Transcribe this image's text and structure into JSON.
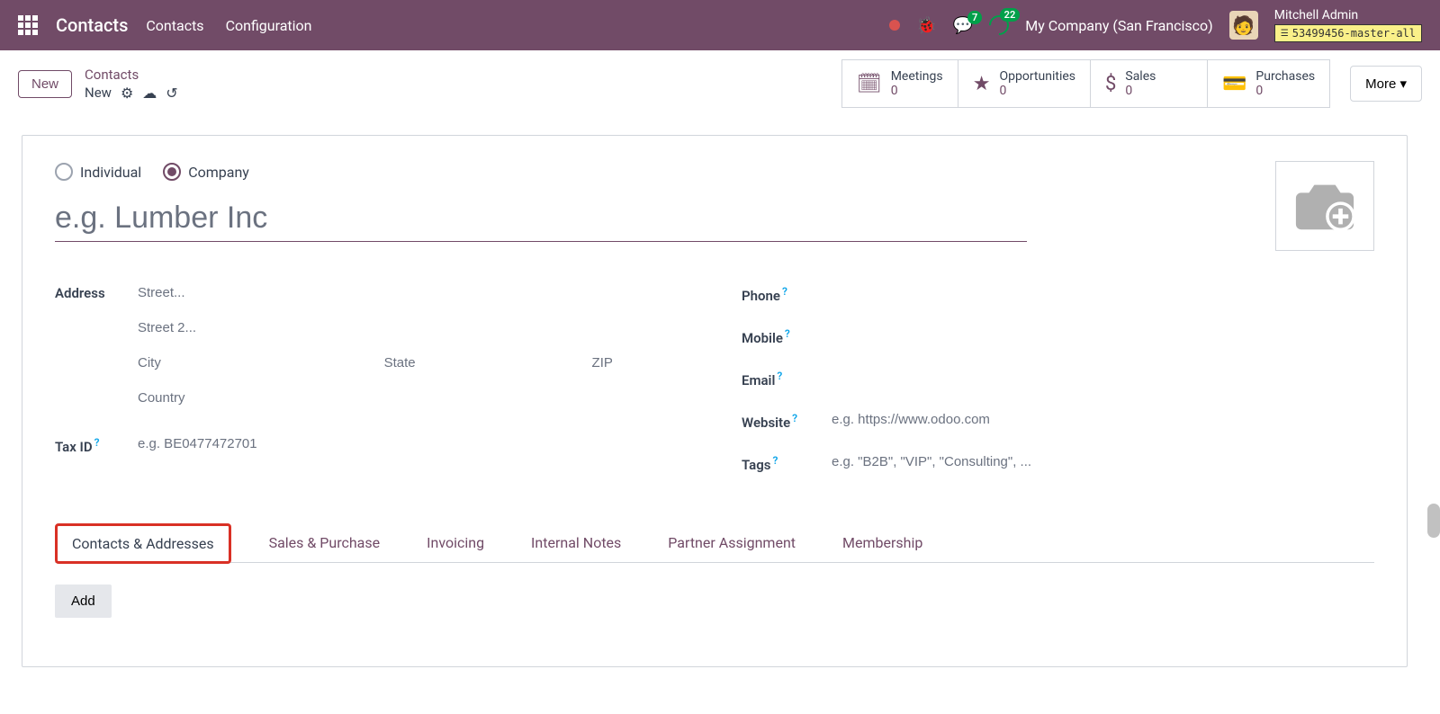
{
  "topnav": {
    "brand": "Contacts",
    "menu": [
      "Contacts",
      "Configuration"
    ],
    "messages_badge": "7",
    "activities_badge": "22",
    "company": "My Company (San Francisco)",
    "user_name": "Mitchell Admin",
    "db_name": "53499456-master-all"
  },
  "breadcrumb": {
    "new_btn": "New",
    "top": "Contacts",
    "bot": "New"
  },
  "stat_buttons": [
    {
      "label": "Meetings",
      "value": "0"
    },
    {
      "label": "Opportunities",
      "value": "0"
    },
    {
      "label": "Sales",
      "value": "0"
    },
    {
      "label": "Purchases",
      "value": "0"
    }
  ],
  "more_label": "More",
  "radios": {
    "individual": "Individual",
    "company": "Company"
  },
  "name_placeholder": "e.g. Lumber Inc",
  "labels": {
    "address": "Address",
    "taxid": "Tax ID",
    "phone": "Phone",
    "mobile": "Mobile",
    "email": "Email",
    "website": "Website",
    "tags": "Tags"
  },
  "placeholders": {
    "street": "Street...",
    "street2": "Street 2...",
    "city": "City",
    "state": "State",
    "zip": "ZIP",
    "country": "Country",
    "taxid": "e.g. BE0477472701",
    "website": "e.g. https://www.odoo.com",
    "tags": "e.g. \"B2B\", \"VIP\", \"Consulting\", ..."
  },
  "tabs": [
    "Contacts & Addresses",
    "Sales & Purchase",
    "Invoicing",
    "Internal Notes",
    "Partner Assignment",
    "Membership"
  ],
  "add_btn": "Add"
}
